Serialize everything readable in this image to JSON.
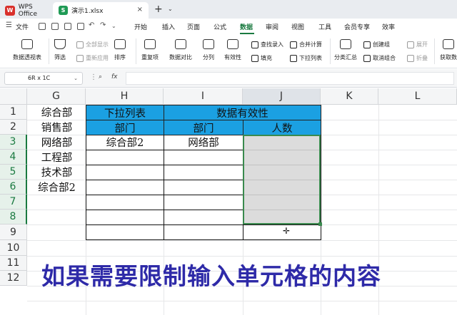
{
  "titlebar": {
    "app_label": "WPS Office",
    "app_icon": "W",
    "file_icon": "S",
    "file_tab": "演示1.xlsx",
    "close": "×",
    "new_tab": "+",
    "new_tab_menu": "⌄"
  },
  "menubar": {
    "file_label": "文件",
    "items": [
      "开始",
      "插入",
      "页面",
      "公式",
      "数据",
      "审阅",
      "视图",
      "工具",
      "会员专享",
      "效率"
    ],
    "active": "数据"
  },
  "ribbon": {
    "pivot": "数据透视表",
    "filter": "筛选",
    "show_all": "全部显示",
    "reapply": "重新应用",
    "sort": "排序",
    "duplicates": "重复项",
    "compare": "数据对比",
    "split": "分列",
    "validity": "有效性",
    "lookup_entry": "查找录入",
    "fill": "填充",
    "consolidate": "合并计算",
    "dropdown_list": "下拉列表",
    "subtotal": "分类汇总",
    "create_group": "创建组",
    "ungroup": "取消组合",
    "expand": "展开",
    "collapse": "折叠",
    "get_data": "获取数"
  },
  "formula_bar": {
    "name_box": "6R x 1C",
    "fx": "fx",
    "formula": ""
  },
  "sheet": {
    "columns": [
      "G",
      "H",
      "I",
      "J",
      "K",
      "L"
    ],
    "selected_column": "J",
    "rows": [
      "1",
      "2",
      "3",
      "4",
      "5",
      "6",
      "7",
      "8",
      "9",
      "10",
      "11",
      "12"
    ],
    "selected_rows": [
      "3",
      "4",
      "5",
      "6",
      "7",
      "8"
    ],
    "g_values": [
      "综合部",
      "销售部",
      "网络部",
      "工程部",
      "技术部",
      "综合部2"
    ],
    "h1": "下拉列表",
    "i1_j1": "数据有效性",
    "h2": "部门",
    "i2": "部门",
    "j2": "人数",
    "h3": "综合部2",
    "i3": "网络部",
    "header_color": "#1ba0e2",
    "selection_color": "#3a8a4e"
  },
  "subtitle": "如果需要限制输入单元格的内容"
}
